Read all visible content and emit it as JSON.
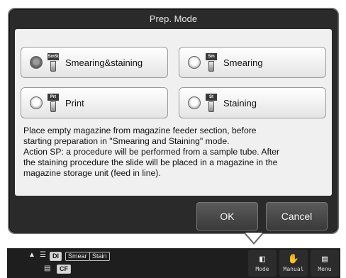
{
  "dialog": {
    "title": "Prep. Mode",
    "modes": [
      {
        "tag": "SmSt",
        "label": "Smearing&staining",
        "selected": true
      },
      {
        "tag": "Sm",
        "label": "Smearing",
        "selected": false
      },
      {
        "tag": "Prt",
        "label": "Print",
        "selected": false
      },
      {
        "tag": "St",
        "label": "Staining",
        "selected": false
      }
    ],
    "description_lines": [
      "Place empty magazine from magazine feeder section, before",
      "starting preparation in \"Smearing and Staining\" mode.",
      "Action SP: a procedure will be performed from a sample tube.  After",
      "the staining procedure the slide will be placed in a magazine in the",
      "magazine storage unit (feed in line)."
    ],
    "ok_label": "OK",
    "cancel_label": "Cancel"
  },
  "statusbar": {
    "tag_di": "DI",
    "tag_smear": "Smear",
    "tag_stain": "Stain",
    "tag_cf": "CF",
    "buttons": [
      {
        "icon": "mode-icon",
        "label": "Mode"
      },
      {
        "icon": "manual-icon",
        "label": "Manual"
      },
      {
        "icon": "menu-icon",
        "label": "Menu"
      }
    ]
  }
}
